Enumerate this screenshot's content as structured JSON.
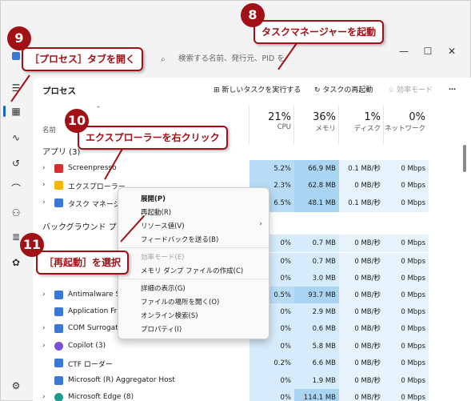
{
  "window": {
    "search_placeholder": "検索する名前、発行元、PID を"
  },
  "toolbar": {
    "title": "プロセス",
    "run_new_task": "新しいタスクを実行する",
    "restart_task": "タスクの再起動",
    "efficiency_mode": "効率モード",
    "more": "…"
  },
  "columns": {
    "name": "名前",
    "cpu_pct": "21%",
    "cpu": "CPU",
    "mem_pct": "36%",
    "mem": "メモリ",
    "disk_pct": "1%",
    "disk": "ディスク",
    "net_pct": "0%",
    "net": "ネットワーク"
  },
  "groups": {
    "apps": "アプリ (3)",
    "background": "バックグラウンド プロ"
  },
  "apps": [
    {
      "name": "Screenpresso",
      "cpu": "5.2%",
      "mem": "66.9 MB",
      "disk": "0.1 MB/秒",
      "net": "0 Mbps",
      "color": "#d32f2f"
    },
    {
      "name": "エクスプローラー",
      "cpu": "2.3%",
      "mem": "62.8 MB",
      "disk": "0 MB/秒",
      "net": "0 Mbps",
      "color": "#f2b705"
    },
    {
      "name": "タスク マネージャー",
      "cpu": "6.5%",
      "mem": "48.1 MB",
      "disk": "0.1 MB/秒",
      "net": "0 Mbps",
      "color": "#3a78d4"
    }
  ],
  "background": [
    {
      "name": "",
      "cpu": "0%",
      "mem": "0.7 MB",
      "disk": "0 MB/秒",
      "net": "0 Mbps",
      "color": "#3a78d4"
    },
    {
      "name": "",
      "cpu": "0%",
      "mem": "0.7 MB",
      "disk": "0 MB/秒",
      "net": "0 Mbps",
      "color": "#3a78d4"
    },
    {
      "name": "",
      "cpu": "0%",
      "mem": "3.0 MB",
      "disk": "0 MB/秒",
      "net": "0 Mbps",
      "color": "#3a78d4"
    },
    {
      "name": "Antimalware Se",
      "cpu": "0.5%",
      "mem": "93.7 MB",
      "disk": "0 MB/秒",
      "net": "0 Mbps",
      "color": "#3a78d4"
    },
    {
      "name": "Application Fra",
      "cpu": "0%",
      "mem": "2.9 MB",
      "disk": "0 MB/秒",
      "net": "0 Mbps",
      "color": "#3a78d4"
    },
    {
      "name": "COM Surrogate",
      "cpu": "0%",
      "mem": "0.6 MB",
      "disk": "0 MB/秒",
      "net": "0 Mbps",
      "color": "#3a78d4"
    },
    {
      "name": "Copilot (3)",
      "cpu": "0%",
      "mem": "5.8 MB",
      "disk": "0 MB/秒",
      "net": "0 Mbps",
      "color": "#7b4fd6"
    },
    {
      "name": "CTF ローダー",
      "cpu": "0.2%",
      "mem": "6.6 MB",
      "disk": "0 MB/秒",
      "net": "0 Mbps",
      "color": "#3a78d4"
    },
    {
      "name": "Microsoft (R) Aggregator Host",
      "cpu": "0%",
      "mem": "1.9 MB",
      "disk": "0 MB/秒",
      "net": "0 Mbps",
      "color": "#3a78d4"
    },
    {
      "name": "Microsoft Edge (8)",
      "cpu": "0%",
      "mem": "114.1 MB",
      "disk": "0 MB/秒",
      "net": "0 Mbps",
      "color": "#1e9c8a"
    }
  ],
  "context_menu": {
    "expand": "展開(P)",
    "restart": "再起動(R)",
    "resource_values": "リソース値(V)",
    "send_feedback": "フィードバックを送る(B)",
    "efficiency_mode": "効率モード(E)",
    "memory_dump": "メモリ ダンプ ファイルの作成(C)",
    "go_to_details": "詳細の表示(G)",
    "open_file_location": "ファイルの場所を開く(O)",
    "search_online": "オンライン検索(S)",
    "properties": "プロパティ(I)"
  },
  "callouts": {
    "c8_num": "8",
    "c8_text": "タスクマネージャーを起動",
    "c9_num": "9",
    "c9_text": "［プロセス］タブを開く",
    "c10_num": "10",
    "c10_text": "エクスプローラーを右クリック",
    "c11_num": "11",
    "c11_text": "［再起動］を選択"
  },
  "colors": {
    "callout": "#a01015",
    "accent": "#1a65c4",
    "heat_cpu": "#b8dcf5",
    "heat_mem": "#a9d4f2"
  }
}
